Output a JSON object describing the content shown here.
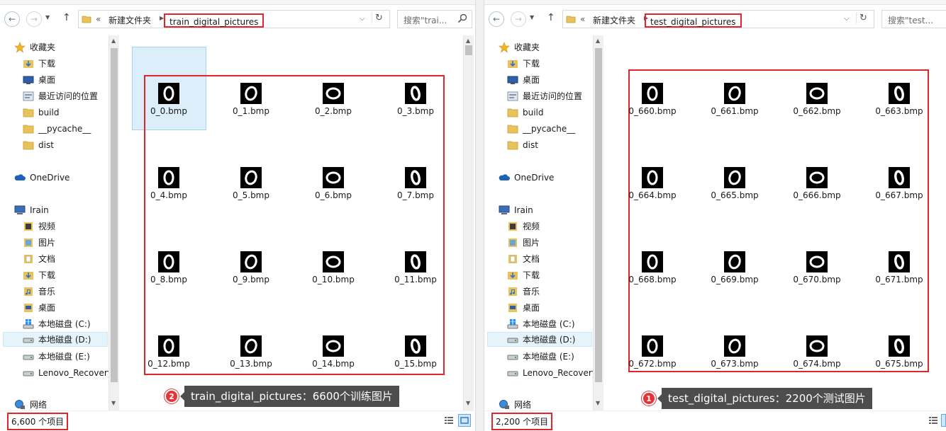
{
  "left": {
    "breadcrumb_parent": "新建文件夹",
    "breadcrumb_sep": "›",
    "breadcrumb_prefix": "«",
    "current_folder": "train_digital_pictures",
    "search_placeholder": "搜索\"trai...",
    "status_count": "6,600 个项目",
    "callout_number": "2",
    "callout_text": "train_digital_pictures：6600个训练图片",
    "files": [
      "0_0.bmp",
      "0_1.bmp",
      "0_2.bmp",
      "0_3.bmp",
      "0_4.bmp",
      "0_5.bmp",
      "0_6.bmp",
      "0_7.bmp",
      "0_8.bmp",
      "0_9.bmp",
      "0_10.bmp",
      "0_11.bmp",
      "0_12.bmp",
      "0_13.bmp",
      "0_14.bmp",
      "0_15.bmp"
    ]
  },
  "right": {
    "breadcrumb_parent": "新建文件夹",
    "breadcrumb_sep": "›",
    "breadcrumb_prefix": "«",
    "current_folder": "test_digital_pictures",
    "search_placeholder": "搜索\"test...",
    "status_count": "2,200 个项目",
    "callout_number": "1",
    "callout_text": "test_digital_pictures：2200个测试图片",
    "files": [
      "0_660.bmp",
      "0_661.bmp",
      "0_662.bmp",
      "0_663.bmp",
      "0_664.bmp",
      "0_665.bmp",
      "0_666.bmp",
      "0_667.bmp",
      "0_668.bmp",
      "0_669.bmp",
      "0_670.bmp",
      "0_671.bmp",
      "0_672.bmp",
      "0_673.bmp",
      "0_674.bmp",
      "0_675.bmp"
    ]
  },
  "sidebar": {
    "favorites": "收藏夹",
    "downloads": "下载",
    "desktop": "桌面",
    "recent": "最近访问的位置",
    "build": "build",
    "pycache": "__pycache__",
    "dist": "dist",
    "onedrive": "OneDrive",
    "pc": "Irain",
    "videos": "视频",
    "pictures": "图片",
    "documents": "文档",
    "downloads2": "下载",
    "music": "音乐",
    "desktop2": "桌面",
    "drive_c": "本地磁盘 (C:)",
    "drive_d": "本地磁盘 (D:)",
    "drive_e": "本地磁盘 (E:)",
    "lenovo": "Lenovo_Recovery",
    "network": "网络"
  },
  "colors": {
    "annotation_red": "#e0252d",
    "callout_bg": "#4d4d4d",
    "selection_blue": "#dbeefa"
  }
}
